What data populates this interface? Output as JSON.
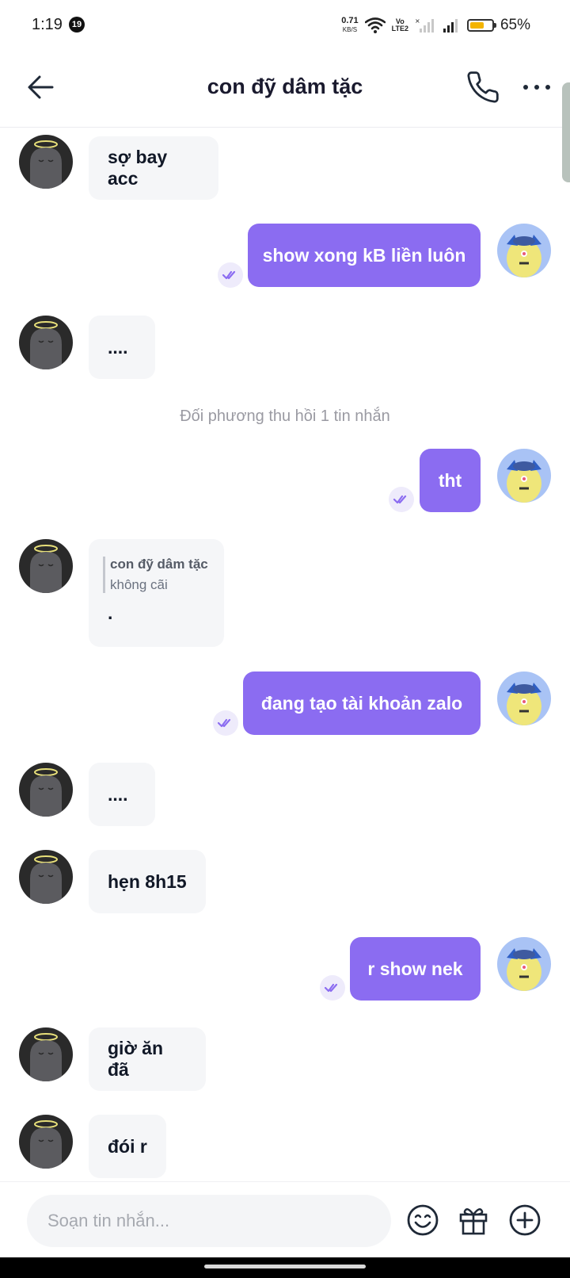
{
  "status_bar": {
    "time": "1:19",
    "notification_count": "19",
    "net_speed_value": "0.71",
    "net_speed_unit": "KB/S",
    "volte_top": "Vo",
    "volte_bottom": "LTE2",
    "battery_percent_text": "65%",
    "battery_level": 0.65,
    "battery_color": "#f3b400"
  },
  "header": {
    "back_icon": "arrow-left-icon",
    "title": "con đỹ dâm tặc",
    "call_icon": "phone-icon",
    "more_icon": "more-dots-icon"
  },
  "messages": [
    {
      "side": "in",
      "text": "sợ bay acc"
    },
    {
      "side": "out",
      "text": "show xong kB liền luôn",
      "status": "read"
    },
    {
      "side": "in",
      "text": "...."
    },
    {
      "side": "system",
      "text": "Đối phương thu hồi 1 tin nhắn"
    },
    {
      "side": "out",
      "text": "tht",
      "status": "read"
    },
    {
      "side": "in",
      "quote_name": "con đỹ dâm tặc",
      "quote_text": "không cãi",
      "text": "."
    },
    {
      "side": "out",
      "text": "đang tạo tài khoản zalo",
      "status": "read"
    },
    {
      "side": "in",
      "text": "...."
    },
    {
      "side": "in",
      "text": "hẹn 8h15"
    },
    {
      "side": "out",
      "text": "r show nek",
      "status": "read"
    },
    {
      "side": "in",
      "text": "giờ ăn đã"
    },
    {
      "side": "in",
      "text": "đói r"
    }
  ],
  "composer": {
    "placeholder": "Soạn tin nhắn...",
    "value": "",
    "emoji_icon": "smiley-icon",
    "gift_icon": "gift-icon",
    "add_icon": "plus-circle-icon"
  },
  "colors": {
    "outgoing_bubble": "#8b6cf1",
    "incoming_bubble": "#f5f6f8",
    "read_check": "#8b6cf1"
  }
}
